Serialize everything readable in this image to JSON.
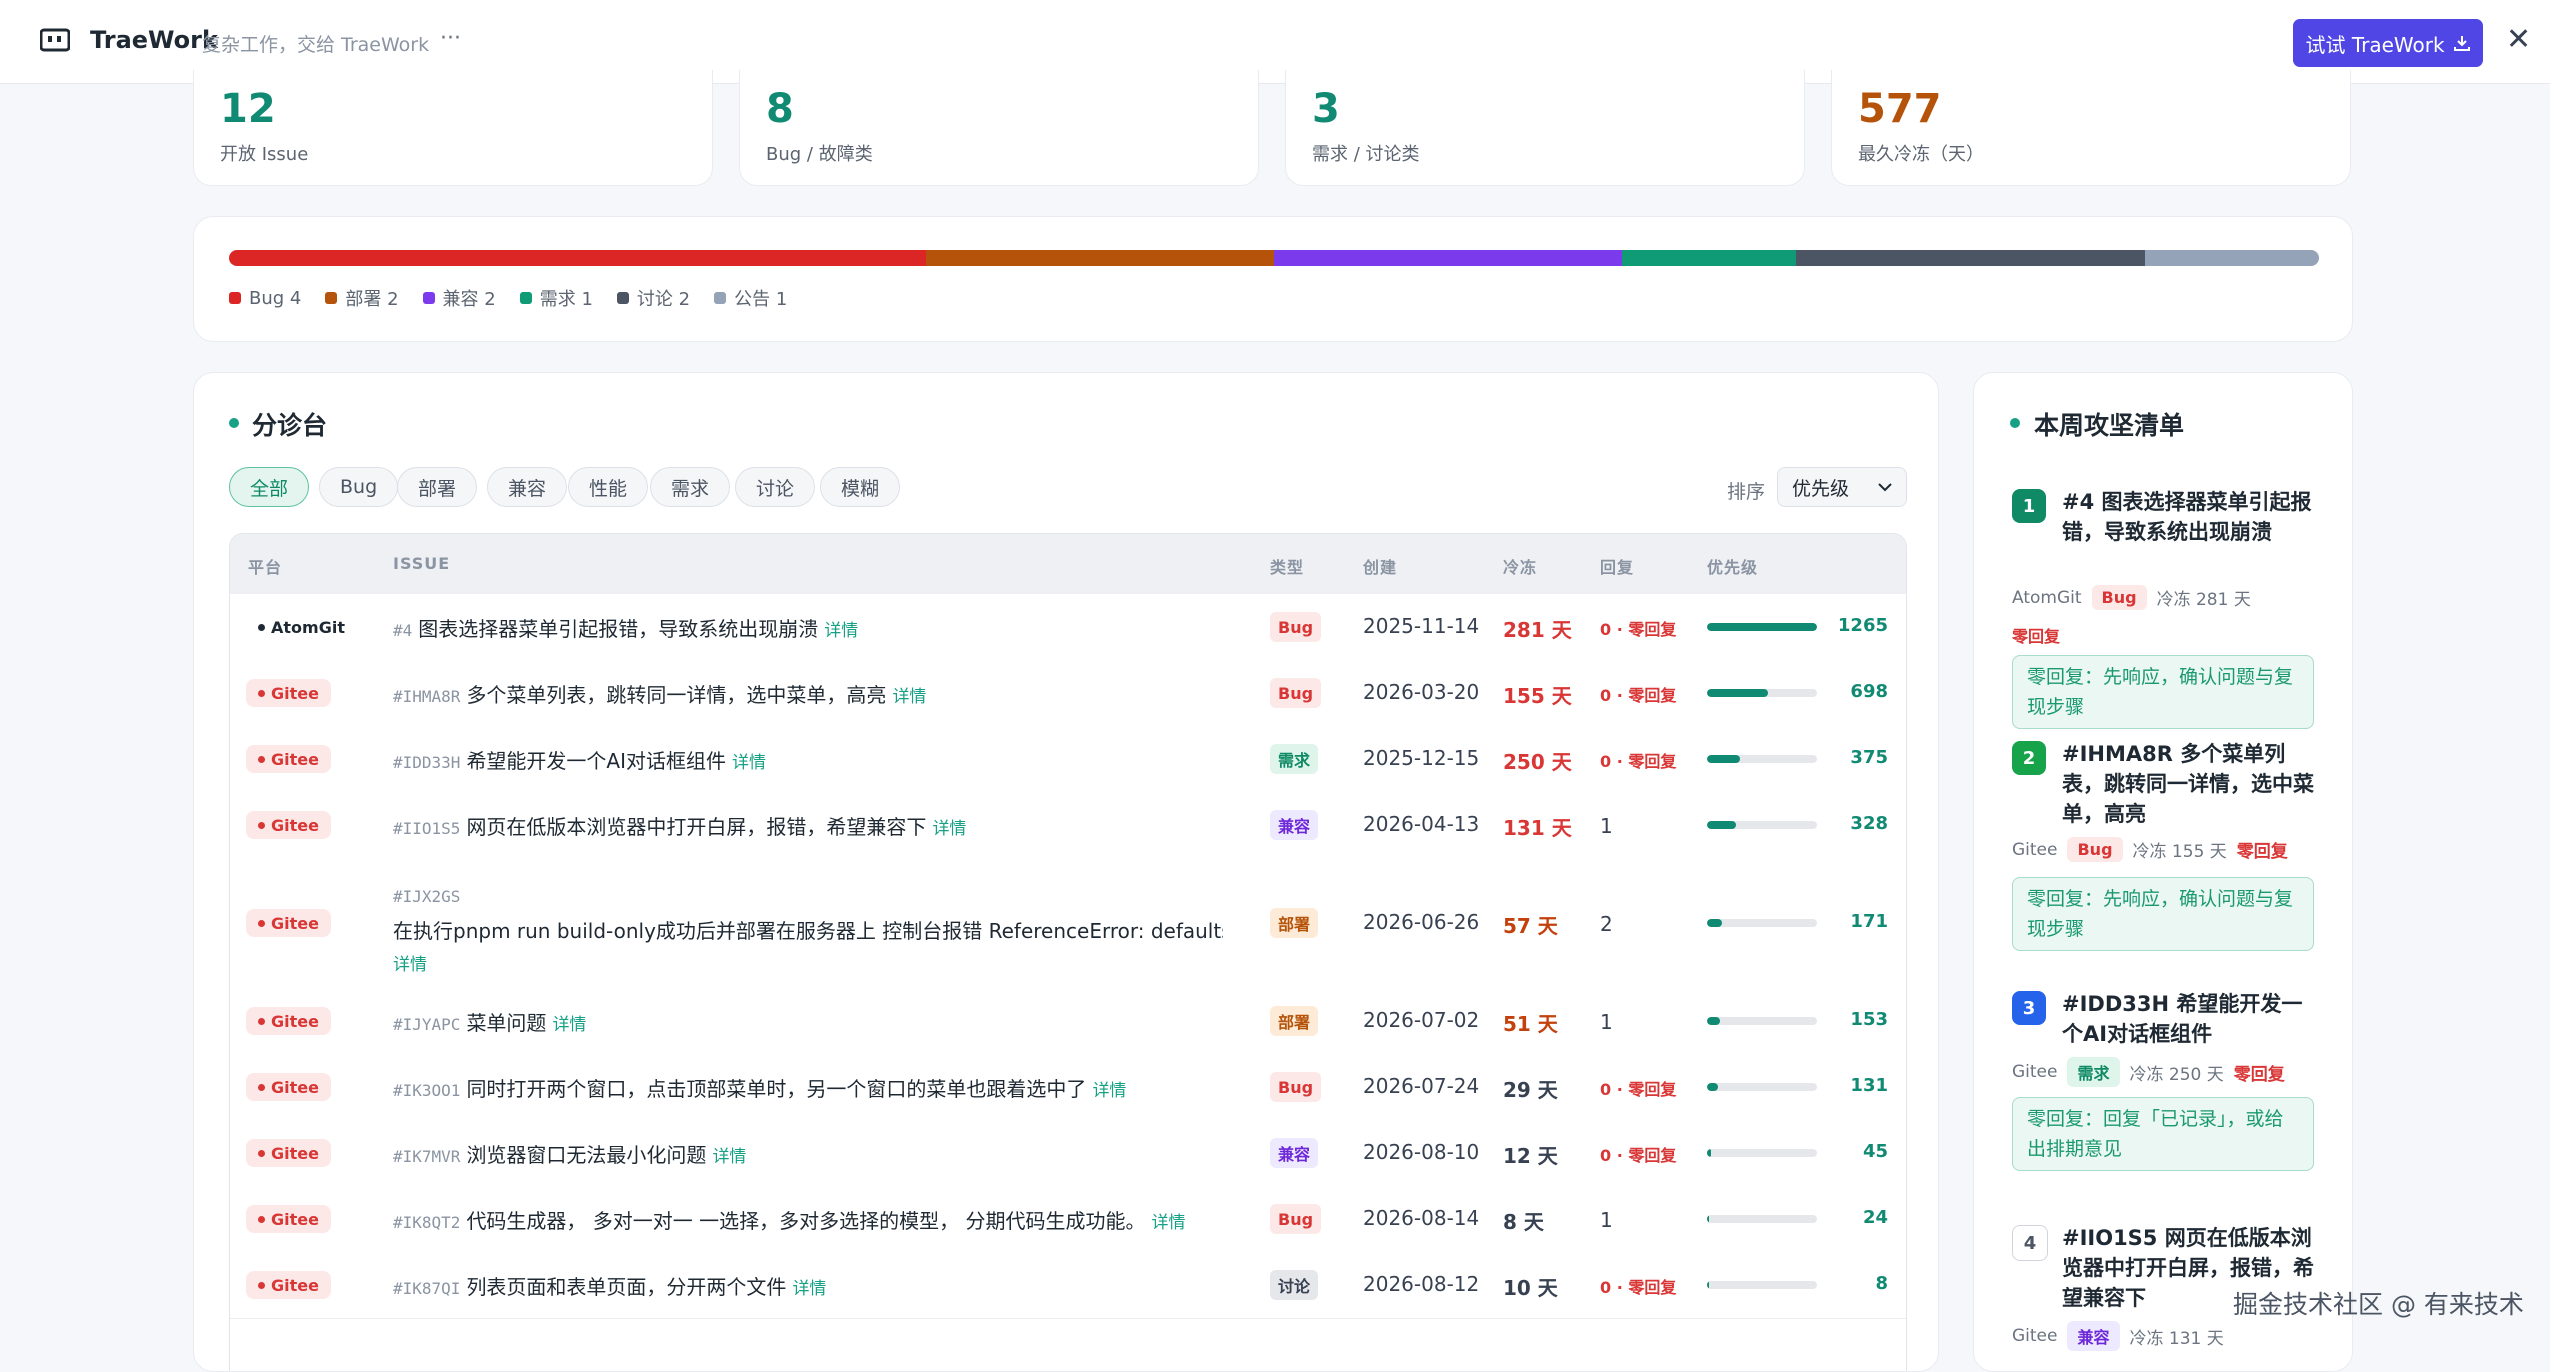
{
  "app": {
    "name": "TraeWork",
    "tagline": "复杂工作，交给 TraeWork",
    "more": "···",
    "try_button": "试试 TraeWork",
    "close": "✕"
  },
  "stats": [
    {
      "value": "12",
      "label": "开放 Issue",
      "color": "#118a73"
    },
    {
      "value": "8",
      "label": "Bug / 故障类",
      "color": "#118a73"
    },
    {
      "value": "3",
      "label": "需求 / 讨论类",
      "color": "#118a73"
    },
    {
      "value": "577",
      "label": "最久冷冻（天）",
      "color": "#b45309"
    }
  ],
  "distribution": [
    {
      "name": "Bug 4",
      "count": 4,
      "color": "#dc2626"
    },
    {
      "name": "部署 2",
      "count": 2,
      "color": "#b45309"
    },
    {
      "name": "兼容 2",
      "count": 2,
      "color": "#7c3aed"
    },
    {
      "name": "需求 1",
      "count": 1,
      "color": "#0f9b75"
    },
    {
      "name": "讨论 2",
      "count": 2,
      "color": "#4b5563"
    },
    {
      "name": "公告 1",
      "count": 1,
      "color": "#94a3b8"
    }
  ],
  "triage": {
    "title": "分诊台",
    "filters": [
      "全部",
      "Bug",
      "部署",
      "兼容",
      "性能",
      "需求",
      "讨论",
      "模糊"
    ],
    "active_filter": "全部",
    "sort_label": "排序",
    "sort_value": "优先级",
    "columns": {
      "platform": "平台",
      "issue": "ISSUE",
      "type": "类型",
      "created": "创建",
      "freeze": "冷冻",
      "reply": "回复",
      "priority": "优先级"
    },
    "rows": [
      {
        "platform": "AtomGit",
        "num": "#4",
        "title": "图表选择器菜单引起报错，导致系统出现崩溃",
        "detail": "详情",
        "type": "Bug",
        "created": "2025-11-14",
        "freeze": "281 天",
        "reply": "0 · 零回复",
        "score": "1265",
        "prio": 1.0,
        "hot": true
      },
      {
        "platform": "Gitee",
        "num": "#IHMA8R",
        "title": "多个菜单列表，跳转同一详情，选中菜单，高亮",
        "detail": "详情",
        "type": "Bug",
        "created": "2026-03-20",
        "freeze": "155 天",
        "reply": "0 · 零回复",
        "score": "698",
        "prio": 0.55,
        "hot": true
      },
      {
        "platform": "Gitee",
        "num": "#IDD33H",
        "title": "希望能开发一个AI对话框组件",
        "detail": "详情",
        "type": "需求",
        "created": "2025-12-15",
        "freeze": "250 天",
        "reply": "0 · 零回复",
        "score": "375",
        "prio": 0.3,
        "hot": true
      },
      {
        "platform": "Gitee",
        "num": "#IIO1S5",
        "title": "网页在低版本浏览器中打开白屏，报错，希望兼容下",
        "detail": "详情",
        "type": "兼容",
        "created": "2026-04-13",
        "freeze": "131 天",
        "reply": "1",
        "score": "328",
        "prio": 0.26,
        "hot": true
      },
      {
        "platform": "Gitee",
        "num": "#IJX2GS",
        "title": "在执行pnpm run build-only成功后并部署在服务器上 控制台报错 ReferenceError: defaults_d...",
        "detail": "详情",
        "type": "部署",
        "created": "2026-06-26",
        "freeze": "57 天",
        "reply": "2",
        "score": "171",
        "prio": 0.14,
        "hot": false
      },
      {
        "platform": "Gitee",
        "num": "#IJYAPC",
        "title": "菜单问题",
        "detail": "详情",
        "type": "部署",
        "created": "2026-07-02",
        "freeze": "51 天",
        "reply": "1",
        "score": "153",
        "prio": 0.12,
        "hot": false
      },
      {
        "platform": "Gitee",
        "num": "#IK3OO1",
        "title": "同时打开两个窗口，点击顶部菜单时，另一个窗口的菜单也跟着选中了",
        "detail": "详情",
        "type": "Bug",
        "created": "2026-07-24",
        "freeze": "29 天",
        "reply": "0 · 零回复",
        "score": "131",
        "prio": 0.1,
        "hot": false
      },
      {
        "platform": "Gitee",
        "num": "#IK7MVR",
        "title": "浏览器窗口无法最小化问题",
        "detail": "详情",
        "type": "兼容",
        "created": "2026-08-10",
        "freeze": "12 天",
        "reply": "0 · 零回复",
        "score": "45",
        "prio": 0.04,
        "hot": false
      },
      {
        "platform": "Gitee",
        "num": "#IK8QT2",
        "title": "代码生成器， 多对一对一 一选择，多对多选择的模型， 分期代码生成功能。",
        "detail": "详情",
        "type": "Bug",
        "created": "2026-08-14",
        "freeze": "8 天",
        "reply": "1",
        "score": "24",
        "prio": 0.02,
        "hot": false
      },
      {
        "platform": "Gitee",
        "num": "#IK87QI",
        "title": "列表页面和表单页面，分开两个文件",
        "detail": "详情",
        "type": "讨论",
        "created": "2026-08-12",
        "freeze": "10 天",
        "reply": "0 · 零回复",
        "score": "8",
        "prio": 0.01,
        "hot": false
      }
    ]
  },
  "weekly": {
    "title": "本周攻坚清单",
    "items": [
      {
        "rank": "1",
        "title": "#4 图表选择器菜单引起报错，导致系统出现崩溃",
        "platform": "AtomGit",
        "type": "Bug",
        "freeze": "冷冻 281 天",
        "zero": "零回复",
        "advice": "零回复：先响应，确认问题与复现步骤"
      },
      {
        "rank": "2",
        "title": "#IHMA8R 多个菜单列表，跳转同一详情，选中菜单，高亮",
        "platform": "Gitee",
        "type": "Bug",
        "freeze": "冷冻 155 天",
        "zero": "零回复",
        "advice": "零回复：先响应，确认问题与复现步骤"
      },
      {
        "rank": "3",
        "title": "#IDD33H 希望能开发一个AI对话框组件",
        "platform": "Gitee",
        "type": "需求",
        "freeze": "冷冻 250 天",
        "zero": "零回复",
        "advice": "零回复：回复「已记录」，或给出排期意见"
      },
      {
        "rank": "4",
        "title": "#IIO1S5 网页在低版本浏览器中打开白屏，报错，希望兼容下",
        "platform": "Gitee",
        "type": "兼容",
        "freeze": "冷冻 131 天",
        "zero": "",
        "advice": ""
      }
    ]
  },
  "type_styles": {
    "Bug": {
      "bg": "#fde8e8",
      "fg": "#d93636"
    },
    "需求": {
      "bg": "#dff5ec",
      "fg": "#0f8a64"
    },
    "兼容": {
      "bg": "#ede9fe",
      "fg": "#6d28d9"
    },
    "部署": {
      "bg": "#fdebd8",
      "fg": "#b45309"
    },
    "讨论": {
      "bg": "#e5e7eb",
      "fg": "#374151"
    }
  },
  "rank_colors": [
    "#0f8a64",
    "#16a34a",
    "#2563eb",
    "#e5e7eb"
  ],
  "watermark": "掘金技术社区 @ 有来技术"
}
